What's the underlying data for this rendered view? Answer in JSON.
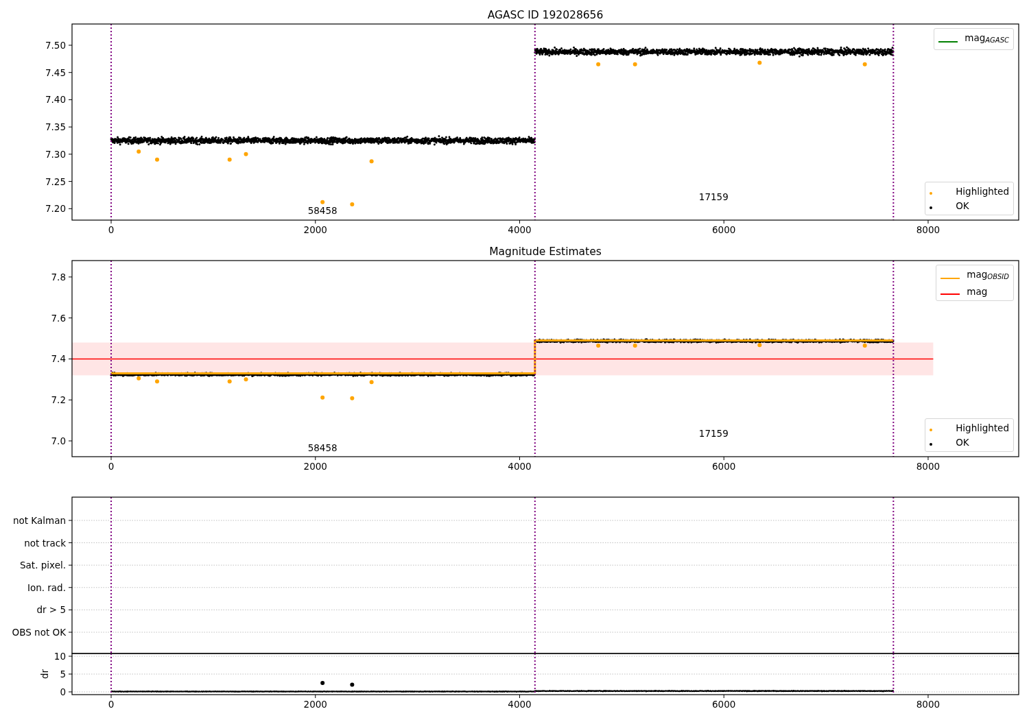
{
  "figure": {
    "panels": [
      {
        "kind": "scatter",
        "chart_data": {
          "type": "scatter",
          "title": "AGASC ID 192028656",
          "xlim": [
            -383,
            8887
          ],
          "ylim": [
            7.179,
            7.539
          ],
          "xticks": [
            0,
            2000,
            4000,
            6000,
            8000
          ],
          "yticks": [
            {
              "value": 7.2,
              "label": "7.20"
            },
            {
              "value": 7.25,
              "label": "7.25"
            },
            {
              "value": 7.3,
              "label": "7.30"
            },
            {
              "value": 7.35,
              "label": "7.35"
            },
            {
              "value": 7.4,
              "label": "7.40"
            },
            {
              "value": 7.45,
              "label": "7.45"
            },
            {
              "value": 7.5,
              "label": "7.50"
            }
          ],
          "series": [
            {
              "color": "#ffa500",
              "x": [
                270,
                450,
                1160,
                1320,
                2070,
                2360,
                2550,
                4770,
                5130,
                6350,
                7380
              ],
              "values": [
                7.305,
                7.29,
                7.29,
                7.3,
                7.212,
                7.208,
                7.287,
                7.465,
                7.465,
                7.468,
                7.465
              ]
            }
          ],
          "ref_lines": [
            {
              "axis": "x",
              "value": 0,
              "color": "#800080"
            },
            {
              "axis": "x",
              "value": 4150,
              "color": "#800080"
            },
            {
              "axis": "x",
              "value": 7660,
              "color": "#800080"
            }
          ],
          "annotations": [
            "58458",
            "17159"
          ]
        },
        "legends": [
          {
            "entries": [
              {
                "kind": "line",
                "label": "mag$_{AGASC}$",
                "color": "#008000"
              }
            ]
          },
          {
            "entries": [
              {
                "kind": "dot",
                "label": "Highlighted",
                "color": "#ffa500"
              },
              {
                "kind": "dot",
                "label": "OK",
                "color": "#000000"
              }
            ]
          }
        ]
      },
      {
        "kind": "scatter",
        "chart_data": {
          "type": "scatter",
          "title": "Magnitude Estimates",
          "xlim": [
            -383,
            8887
          ],
          "ylim": [
            6.923,
            7.88
          ],
          "xticks": [
            0,
            2000,
            4000,
            6000,
            8000
          ],
          "yticks": [
            {
              "value": 7.0,
              "label": "7.0"
            },
            {
              "value": 7.2,
              "label": "7.2"
            },
            {
              "value": 7.4,
              "label": "7.4"
            },
            {
              "value": 7.6,
              "label": "7.6"
            },
            {
              "value": 7.8,
              "label": "7.8"
            }
          ],
          "series": [
            {
              "type": "line",
              "color": "#ff0000",
              "x": [
                -383,
                8050
              ],
              "values": [
                7.4,
                7.4
              ]
            },
            {
              "type": "line",
              "color": "#ffa500",
              "x": [
                0,
                4150,
                4150,
                7660
              ],
              "values": [
                7.33,
                7.33,
                7.49,
                7.49
              ]
            },
            {
              "color": "#ffa500",
              "x": [
                270,
                450,
                1160,
                1320,
                2070,
                2360,
                2550,
                4770,
                5130,
                6350,
                7380
              ],
              "values": [
                7.305,
                7.29,
                7.29,
                7.3,
                7.212,
                7.208,
                7.287,
                7.465,
                7.465,
                7.468,
                7.465
              ]
            }
          ],
          "bands": [
            {
              "axis": "y",
              "from": 7.32,
              "to": 7.48,
              "color": "#ffe5e5"
            }
          ],
          "ref_lines": [
            {
              "axis": "x",
              "value": 0,
              "color": "#800080"
            },
            {
              "axis": "x",
              "value": 4150,
              "color": "#800080"
            },
            {
              "axis": "x",
              "value": 7660,
              "color": "#800080"
            }
          ],
          "annotations": [
            "58458",
            "17159"
          ]
        },
        "legends": [
          {
            "entries": [
              {
                "kind": "line",
                "label": "mag$_{OBSID}$",
                "color": "#ffa500"
              },
              {
                "kind": "line",
                "label": "mag",
                "color": "#ff0000"
              }
            ]
          },
          {
            "entries": [
              {
                "kind": "dot",
                "label": "Highlighted",
                "color": "#ffa500"
              },
              {
                "kind": "dot",
                "label": "OK",
                "color": "#000000"
              }
            ]
          }
        ]
      },
      {
        "kind": "flags",
        "chart_data": {
          "type": "other",
          "categories": [
            "OBS not OK",
            "dr > 5",
            "Ion. rad.",
            "Sat. pixel.",
            "not track",
            "not Kalman"
          ]
        }
      },
      {
        "kind": "scatter",
        "chart_data": {
          "type": "scatter",
          "ylabel": "dr",
          "grid": true,
          "xlim": [
            -383,
            8887
          ],
          "ylim": [
            -0.77,
            10.77
          ],
          "xticks": [
            0,
            2000,
            4000,
            6000,
            8000
          ],
          "yticks": [
            0,
            5,
            10
          ],
          "series": [
            {
              "color": "#000000",
              "x": [
                2070,
                2360
              ],
              "values": [
                2.5,
                2
              ]
            }
          ],
          "ref_lines": [
            {
              "axis": "x",
              "value": 0,
              "color": "#800080"
            },
            {
              "axis": "x",
              "value": 4150,
              "color": "#800080"
            },
            {
              "axis": "x",
              "value": 7660,
              "color": "#800080"
            }
          ]
        }
      }
    ]
  }
}
